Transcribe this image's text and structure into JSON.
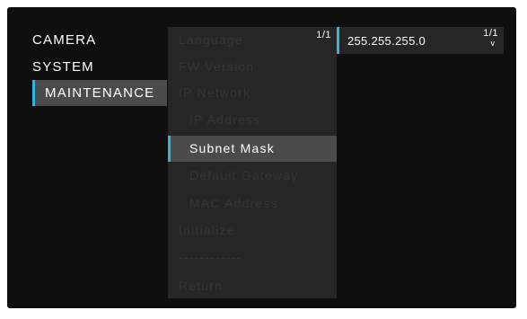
{
  "main_menu": {
    "items": [
      {
        "label": "CAMERA"
      },
      {
        "label": "SYSTEM"
      },
      {
        "label": "MAINTENANCE"
      }
    ]
  },
  "sub_menu": {
    "page_indicator": "1/1",
    "items": [
      {
        "label": "Language"
      },
      {
        "label": "FW Version"
      },
      {
        "label": "IP Network"
      },
      {
        "label": "IP Address"
      },
      {
        "label": "Subnet Mask"
      },
      {
        "label": "Default Gateway"
      },
      {
        "label": "MAC Address"
      },
      {
        "label": "Initialize"
      },
      {
        "label": "------------"
      },
      {
        "label": "Return"
      }
    ]
  },
  "value_panel": {
    "value": "255.255.255.0",
    "page_indicator": "1/1",
    "arrow_icon": "down-arrow",
    "arrow_glyph": "v"
  },
  "colors": {
    "accent": "#2fb6d8",
    "panel": "#262626",
    "selection": "#4b4b4b",
    "background": "#0e0e0e"
  }
}
